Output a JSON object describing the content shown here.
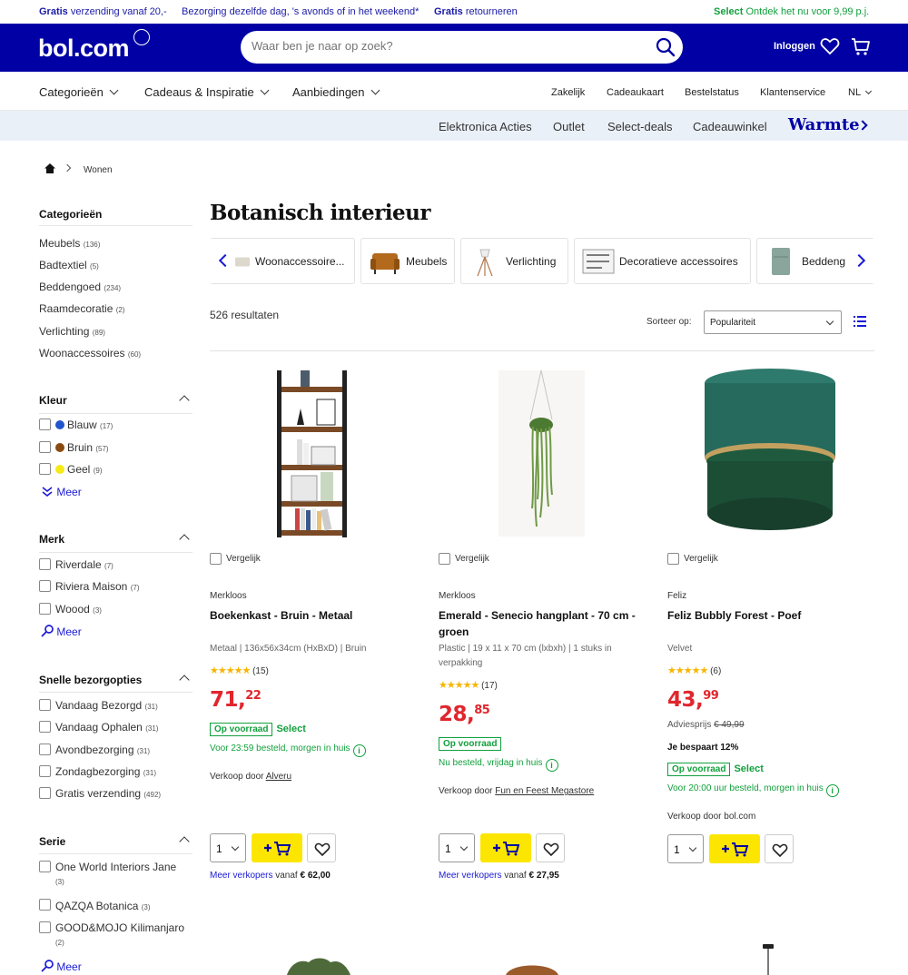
{
  "promo": {
    "left_bold": "Gratis",
    "left_text": " verzending vanaf 20,-",
    "mid_text": "Bezorging dezelfde dag, 's avonds of in het weekend*",
    "ret_bold": "Gratis",
    "ret_text": " retourneren",
    "select_bold": "Select",
    "select_text": " Ontdek het nu voor 9,99 p.j."
  },
  "header": {
    "logo": "bol.com",
    "search_placeholder": "Waar ben je naar op zoek?",
    "login": "Inloggen"
  },
  "nav": {
    "categories": "Categorieën",
    "gifts": "Cadeaus & Inspiratie",
    "offers": "Aanbiedingen",
    "business": "Zakelijk",
    "giftcard": "Cadeaukaart",
    "order_status": "Bestelstatus",
    "service": "Klantenservice",
    "lang": "NL"
  },
  "subnav": {
    "items": [
      "Elektronica Acties",
      "Outlet",
      "Select-deals",
      "Cadeauwinkel"
    ],
    "highlight": "Warmte"
  },
  "breadcrumb": {
    "current": "Wonen"
  },
  "sidebar": {
    "categories_title": "Categorieën",
    "categories": [
      {
        "label": "Meubels",
        "count": "(136)"
      },
      {
        "label": "Badtextiel",
        "count": "(5)"
      },
      {
        "label": "Beddengoed",
        "count": "(234)"
      },
      {
        "label": "Raamdecoratie",
        "count": "(2)"
      },
      {
        "label": "Verlichting",
        "count": "(89)"
      },
      {
        "label": "Woonaccessoires",
        "count": "(60)"
      }
    ],
    "color_title": "Kleur",
    "colors": [
      {
        "label": "Blauw",
        "count": "(17)",
        "swatch": "#2255cc"
      },
      {
        "label": "Bruin",
        "count": "(57)",
        "swatch": "#8a4b10"
      },
      {
        "label": "Geel",
        "count": "(9)",
        "swatch": "#f5ea18"
      }
    ],
    "meer": "Meer",
    "brand_title": "Merk",
    "brands": [
      {
        "label": "Riverdale",
        "count": "(7)"
      },
      {
        "label": "Riviera Maison",
        "count": "(7)"
      },
      {
        "label": "Woood",
        "count": "(3)"
      }
    ],
    "delivery_title": "Snelle bezorgopties",
    "delivery": [
      {
        "label": "Vandaag Bezorgd",
        "count": "(31)"
      },
      {
        "label": "Vandaag Ophalen",
        "count": "(31)"
      },
      {
        "label": "Avondbezorging",
        "count": "(31)"
      },
      {
        "label": "Zondagbezorging",
        "count": "(31)"
      },
      {
        "label": "Gratis verzending",
        "count": "(492)"
      }
    ],
    "series_title": "Serie",
    "series": [
      {
        "label": "One World Interiors Jane",
        "count": "(3)"
      },
      {
        "label": "QAZQA Botanica",
        "count": "(3)"
      },
      {
        "label": "GOOD&MOJO Kilimanjaro",
        "count": "(2)"
      }
    ]
  },
  "main": {
    "title": "Botanisch interieur",
    "category_cards": [
      "Woonaccessoire...",
      "Meubels",
      "Verlichting",
      "Decoratieve accessoires",
      "Beddeng"
    ],
    "results": "526 resultaten",
    "sort_label": "Sorteer op:",
    "sort_value": "Populariteit"
  },
  "products": [
    {
      "compare": "Vergelijk",
      "brand": "Merkloos",
      "name": "Boekenkast - Bruin - Metaal",
      "spec": "Metaal | 136x56x34cm (HxBxD) | Bruin",
      "rating": "(15)",
      "stars": "★★★★★",
      "price_int": "71,",
      "price_dec": "22",
      "preorder": "Op voorraad",
      "select": "Select",
      "delivery": "Voor 23:59 besteld, morgen in huis",
      "seller_prefix": "Verkoop door ",
      "seller": "Alveru",
      "qty": "1",
      "more_sellers": "Meer verkopers",
      "from": " vanaf ",
      "from_price": "€ 62,00"
    },
    {
      "compare": "Vergelijk",
      "brand": "Merkloos",
      "name": "Emerald - Senecio hangplant - 70 cm - groen",
      "spec": "Plastic | 19 x 11 x 70 cm (lxbxh) | 1 stuks in verpakking",
      "rating": "(17)",
      "stars": "★★★★★",
      "price_int": "28,",
      "price_dec": "85",
      "preorder": "Op voorraad",
      "delivery": "Nu besteld, vrijdag in huis",
      "seller_prefix": "Verkoop door ",
      "seller": "Fun en Feest Megastore",
      "qty": "1",
      "more_sellers": "Meer verkopers",
      "from": " vanaf ",
      "from_price": "€ 27,95"
    },
    {
      "compare": "Vergelijk",
      "brand": "Feliz",
      "name": "Feliz Bubbly Forest - Poef",
      "spec": "Velvet",
      "rating": "(6)",
      "stars": "★★★★★",
      "price_int": "43,",
      "price_dec": "99",
      "advies_label": "Adviesprijs ",
      "advies_price": "€ 49,99",
      "saving": "Je bespaart 12%",
      "preorder": "Op voorraad",
      "select": "Select",
      "delivery": "Voor 20:00 uur besteld, morgen in huis",
      "seller_prefix": "Verkoop door ",
      "seller": "bol.com",
      "qty": "1"
    }
  ],
  "info_glyph": "i",
  "colors": {
    "brand_blue": "#0000a4",
    "accent_yellow": "#fce600",
    "price_red": "#e0262d",
    "stock_green": "#12a03c",
    "link_blue": "#1a1ad6"
  }
}
